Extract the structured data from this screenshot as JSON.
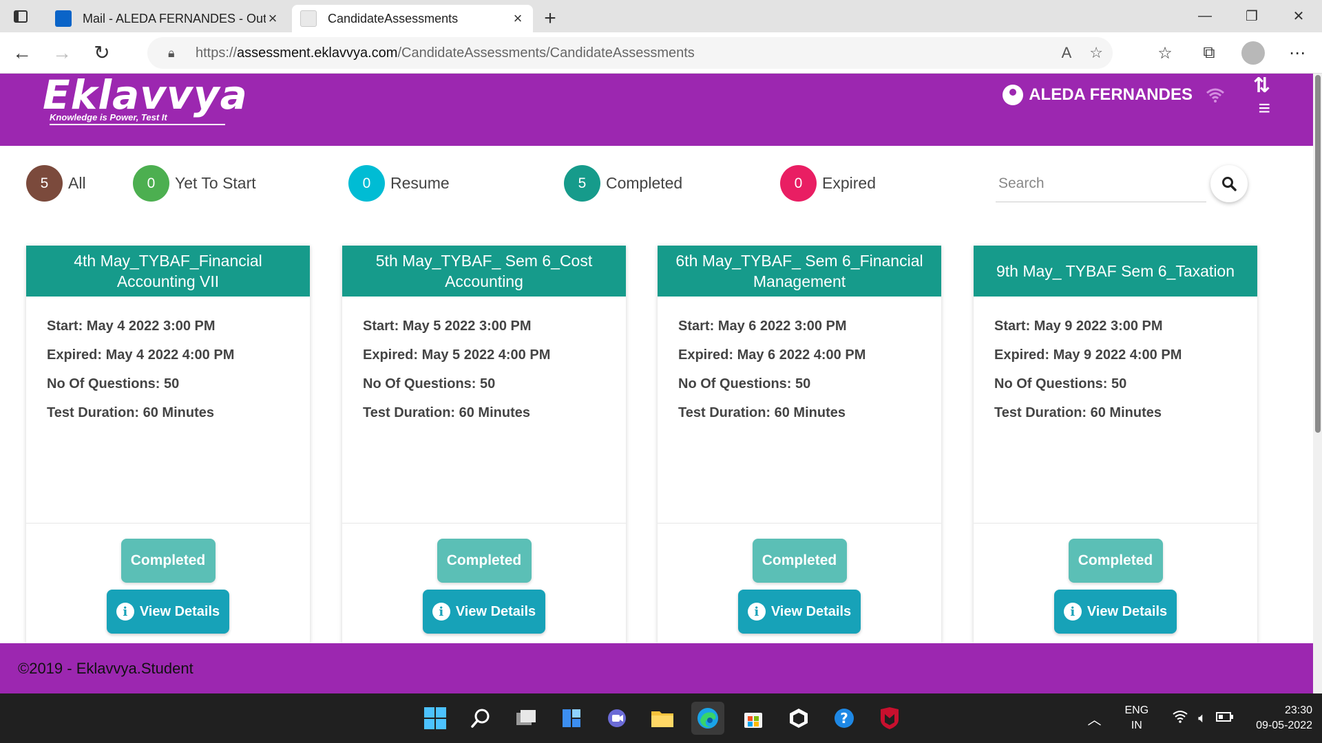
{
  "browser": {
    "tabs": [
      {
        "title": "Mail - ALEDA FERNANDES - Outl",
        "favicon_color": "#0a64c8",
        "active": false
      },
      {
        "title": "CandidateAssessments",
        "favicon_color": "#c9c9c9",
        "active": true
      }
    ],
    "url_prefix": "https://",
    "url_host": "assessment.eklavvya.com",
    "url_path": "/CandidateAssessments/CandidateAssessments"
  },
  "header": {
    "logo_text": "Eklavvya",
    "logo_tagline": "Knowledge is Power, Test It",
    "user_name": "ALEDA FERNANDES",
    "brand_color": "#9c27b0"
  },
  "filters": [
    {
      "count": "5",
      "label": "All",
      "color": "#7b4a3c"
    },
    {
      "count": "0",
      "label": "Yet To Start",
      "color": "#4caf50"
    },
    {
      "count": "0",
      "label": "Resume",
      "color": "#00bcd4"
    },
    {
      "count": "5",
      "label": "Completed",
      "color": "#169b8b"
    },
    {
      "count": "0",
      "label": "Expired",
      "color": "#e91e63"
    }
  ],
  "search": {
    "placeholder": "Search"
  },
  "cards": [
    {
      "title": "4th May_TYBAF_Financial Accounting VII",
      "start": "Start: May 4 2022 3:00 PM",
      "expired": "Expired: May 4 2022 4:00 PM",
      "questions": "No Of Questions: 50",
      "duration": "Test Duration: 60 Minutes",
      "status": "Completed",
      "details": "View Details"
    },
    {
      "title": "5th May_TYBAF_ Sem 6_Cost Accounting",
      "start": "Start: May 5 2022 3:00 PM",
      "expired": "Expired: May 5 2022 4:00 PM",
      "questions": "No Of Questions: 50",
      "duration": "Test Duration: 60 Minutes",
      "status": "Completed",
      "details": "View Details"
    },
    {
      "title": "6th May_TYBAF_ Sem 6_Financial Management",
      "start": "Start: May 6 2022 3:00 PM",
      "expired": "Expired: May 6 2022 4:00 PM",
      "questions": "No Of Questions: 50",
      "duration": "Test Duration: 60 Minutes",
      "status": "Completed",
      "details": "View Details"
    },
    {
      "title": "9th May_ TYBAF Sem 6_Taxation",
      "start": "Start: May 9 2022 3:00 PM",
      "expired": "Expired: May 9 2022 4:00 PM",
      "questions": "No Of Questions: 50",
      "duration": "Test Duration: 60 Minutes",
      "status": "Completed",
      "details": "View Details"
    }
  ],
  "footer": {
    "text": "©2019 - Eklavvya.Student"
  },
  "taskbar": {
    "lang_line1": "ENG",
    "lang_line2": "IN",
    "time": "23:30",
    "date": "09-05-2022"
  }
}
